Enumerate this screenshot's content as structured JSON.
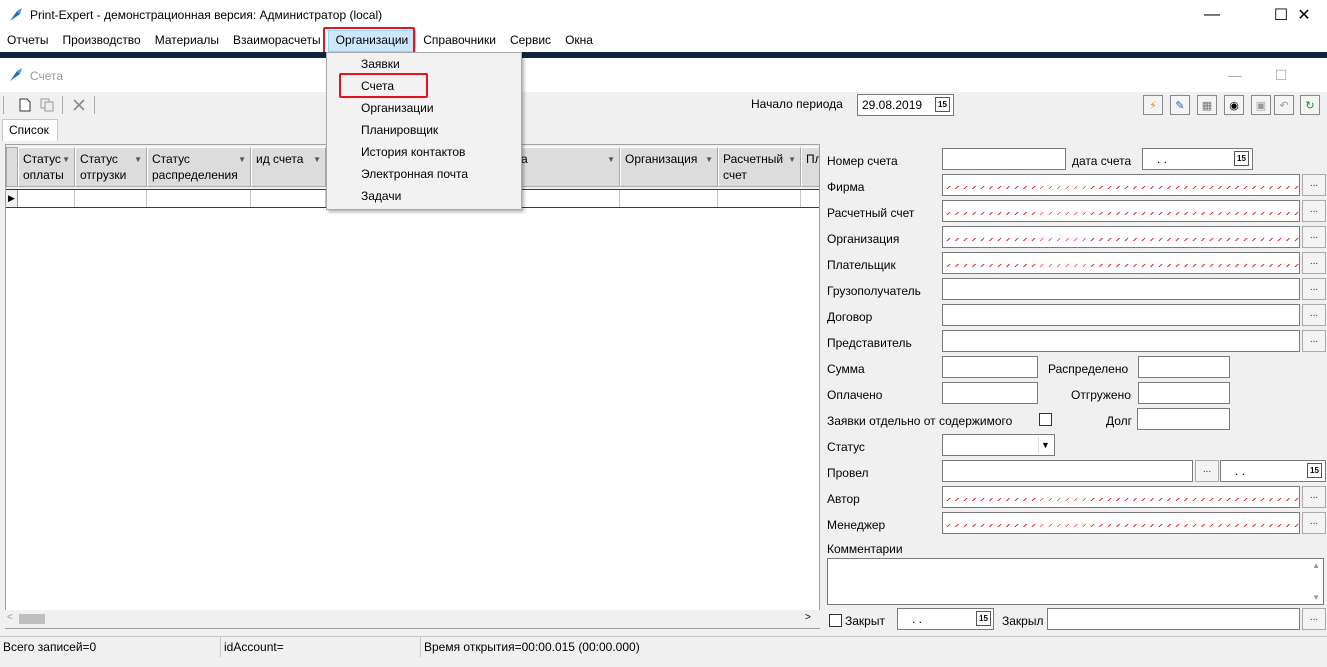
{
  "app": {
    "title": "Print-Expert - демонстрационная версия: Администратор (local)",
    "minimize": "—",
    "maximize": "☐",
    "close": "✕"
  },
  "menubar": {
    "items": [
      "Отчеты",
      "Производство",
      "Материалы",
      "Взаиморасчеты",
      "Организации",
      "Справочники",
      "Сервис",
      "Окна"
    ],
    "active_index": 4
  },
  "dropdown": {
    "items": [
      "Заявки",
      "Счета",
      "Организации",
      "Планировщик",
      "История контактов",
      "Электронная почта",
      "Задачи"
    ],
    "highlighted_index": 1
  },
  "child_window": {
    "title": "Счета"
  },
  "toolbar": {
    "period_label": "Начало периода",
    "period_value": "29.08.2019"
  },
  "tabs": [
    "Список"
  ],
  "grid": {
    "columns": [
      {
        "label": "Статус\nоплаты"
      },
      {
        "label": "Статус\nотгрузки"
      },
      {
        "label": "Статус\nраспределения"
      },
      {
        "label": "ид счета"
      },
      {
        "label": "а"
      },
      {
        "label": "Организация"
      },
      {
        "label": "Расчетный\nсчет"
      },
      {
        "label": "Пл"
      }
    ],
    "row_indicator": "▶"
  },
  "form": {
    "invoice_number_label": "Номер счета",
    "invoice_date_label": "дата счета",
    "invoice_date_value": ". .",
    "firm_label": "Фирма",
    "account_label": "Расчетный счет",
    "organization_label": "Организация",
    "payer_label": "Плательщик",
    "consignee_label": "Грузополучатель",
    "contract_label": "Договор",
    "representative_label": "Представитель",
    "sum_label": "Сумма",
    "distributed_label": "Распределено",
    "paid_label": "Оплачено",
    "shipped_label": "Отгружено",
    "separate_label": "Заявки отдельно от содержимого",
    "debt_label": "Долг",
    "status_label": "Статус",
    "posted_label": "Провел",
    "posted_date_value": ". .",
    "author_label": "Автор",
    "manager_label": "Менеджер",
    "comments_label": "Комментарии",
    "closed_label": "Закрыт",
    "closed_date_value": ". .",
    "closed_by_label": "Закрыл",
    "dots": "..."
  },
  "statusbar": {
    "records": "Всего записей=0",
    "id": "idAccount=",
    "time": "Время открытия=00:00.015 (00:00.000)"
  }
}
